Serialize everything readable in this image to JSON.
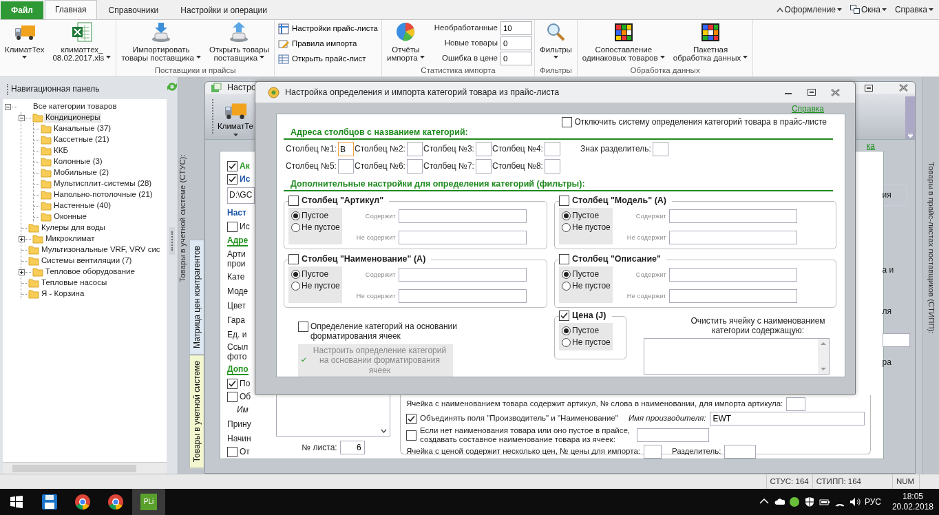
{
  "menu_tabs": [
    {
      "label": "Файл",
      "kind": "file",
      "selected": false
    },
    {
      "label": "Главная",
      "kind": "tab",
      "selected": true
    },
    {
      "label": "Справочники",
      "kind": "tab",
      "selected": false
    },
    {
      "label": "Настройки и операции",
      "kind": "tab",
      "selected": false
    }
  ],
  "top_menus": [
    "Оформление",
    "Окна",
    "Справка"
  ],
  "ribbon_groups": [
    {
      "kind": "large",
      "buttons": [
        {
          "lines": [
            "КлиматТех"
          ],
          "dropdown": true
        },
        {
          "lines": [
            "климаттех_",
            "08.02.2017.xls"
          ],
          "dropdown": true
        }
      ]
    },
    {
      "kind": "large",
      "label": "Поставщики и прайсы",
      "buttons": [
        {
          "lines": [
            "Импортировать",
            "товары поставщика"
          ],
          "dropdown": true
        },
        {
          "lines": [
            "Открыть товары",
            "поставщика"
          ],
          "dropdown": true
        }
      ]
    },
    {
      "kind": "small",
      "buttons": [
        {
          "lines": [
            "Настройки прайс-листа"
          ]
        },
        {
          "lines": [
            "Правила импорта"
          ]
        },
        {
          "lines": [
            "Открыть прайс-лист"
          ]
        }
      ]
    },
    {
      "kind": "stats",
      "label": "Статистика импорта",
      "buttons": [
        {
          "lines": [
            "Отчёты",
            "импорта"
          ],
          "dropdown": true
        }
      ],
      "fields": [
        {
          "label": "Необработанные",
          "value": "10"
        },
        {
          "label": "Новые товары",
          "value": "0"
        },
        {
          "label": "Ошибка в цене",
          "value": "0"
        }
      ]
    },
    {
      "kind": "large",
      "label": "Фильтры",
      "buttons": [
        {
          "lines": [
            "Фильтры"
          ],
          "dropdown": true
        }
      ]
    },
    {
      "kind": "large",
      "label": "Обработка данных",
      "buttons": [
        {
          "lines": [
            "Сопоставление",
            "одинаковых товаров"
          ],
          "dropdown": true
        },
        {
          "lines": [
            "Пакетная",
            "обработка данных"
          ],
          "dropdown": true
        }
      ]
    }
  ],
  "nav_panel": {
    "title": "Навигационная панель",
    "tree": [
      {
        "label": "Все категории товаров",
        "selected": false,
        "expanded": true,
        "children": [
          {
            "label": "Кондиционеры",
            "selected": true,
            "expanded": true,
            "children": [
              {
                "label": "Канальные (37)",
                "selected": false
              },
              {
                "label": "Кассетные (21)",
                "selected": false
              },
              {
                "label": "ККБ",
                "selected": false
              },
              {
                "label": "Колонные (3)",
                "selected": false
              },
              {
                "label": "Мобильные (2)",
                "selected": false
              },
              {
                "label": "Мультисплит-системы (28)",
                "selected": false
              },
              {
                "label": "Напольно-потолочные (21)",
                "selected": false
              },
              {
                "label": "Настенные (40)",
                "selected": false
              },
              {
                "label": "Оконные",
                "selected": false
              }
            ]
          },
          {
            "label": "Кулеры для воды",
            "selected": false
          },
          {
            "label": "Микроклимат",
            "selected": false,
            "expanded": false
          },
          {
            "label": "Мультизональные VRF, VRV сис",
            "selected": false
          },
          {
            "label": "Системы вентиляции (7)",
            "selected": false
          },
          {
            "label": "Тепловое оборудование",
            "selected": false,
            "expanded": false
          },
          {
            "label": "Тепловые насосы",
            "selected": false
          },
          {
            "label": "Я - Корзина",
            "selected": false
          }
        ]
      }
    ]
  },
  "side_strip": {
    "caption": "Товары в учетной системе (СТУС):",
    "tabs": [
      {
        "label": "Матрица цен контрагентов",
        "selected": false
      },
      {
        "label": "Товары в учетной системе",
        "selected": true
      }
    ]
  },
  "background_window": {
    "title": "Настро",
    "toolbar_button": "КлиматТе",
    "help_link": "ка",
    "left_fragments": [
      {
        "kind": "check-heading",
        "checked": true,
        "text": "Ак",
        "color": "#24951f"
      },
      {
        "kind": "check-heading",
        "checked": true,
        "text": "Ис",
        "color": "#1c56a8"
      },
      {
        "kind": "field",
        "text": "D:\\GC"
      },
      {
        "kind": "heading",
        "text": "Наст",
        "color": "#1c56a8",
        "underline": false
      },
      {
        "kind": "check",
        "checked": false,
        "text": "Ис"
      },
      {
        "kind": "heading",
        "text": "Адре",
        "color": "#24951f",
        "underline": true
      },
      {
        "kind": "text",
        "lines": [
          "Арти",
          "прои"
        ]
      },
      {
        "kind": "text",
        "lines": [
          "Кате"
        ]
      },
      {
        "kind": "text",
        "lines": [
          "Моде"
        ]
      },
      {
        "kind": "text",
        "lines": [
          "Цвет"
        ]
      },
      {
        "kind": "text",
        "lines": [
          "Гара"
        ]
      },
      {
        "kind": "text",
        "lines": [
          "Ед. и"
        ]
      },
      {
        "kind": "text",
        "lines": [
          "Ссыл",
          "фото"
        ]
      },
      {
        "kind": "heading",
        "text": "Допо",
        "color": "#24951f",
        "underline": true
      },
      {
        "kind": "check",
        "checked": true,
        "text": "По"
      },
      {
        "kind": "check",
        "checked": false,
        "text": "Об"
      },
      {
        "kind": "italic",
        "text": "Им"
      },
      {
        "kind": "text",
        "lines": [
          "Прину"
        ]
      },
      {
        "kind": "text",
        "lines": [
          "Начин"
        ]
      },
      {
        "kind": "check",
        "checked": false,
        "text": "От"
      }
    ],
    "right_fragments": [
      {
        "kind": "boxed",
        "text": "ия"
      },
      {
        "kind": "text",
        "text": "а и"
      },
      {
        "kind": "text",
        "text": "ля"
      },
      {
        "kind": "field"
      },
      {
        "kind": "text",
        "text": "ра"
      }
    ],
    "sheet_number": {
      "label": "№ листа:",
      "value": "6"
    },
    "options": [
      {
        "kind": "short",
        "text": "Ячейка с наименованием товара содержит артикул, № слова в наименовании, для импорта артикула:"
      },
      {
        "kind": "merge",
        "checked": true,
        "text": "Объединять поля \"Производитель\" и \"Наименование\"",
        "extra_label": "Имя производителя:",
        "value": "EWT"
      },
      {
        "kind": "compose",
        "checked": false,
        "text": "Если нет наименования товара или оно пустое в прайсе, создавать составное наименование товара из ячеек:"
      },
      {
        "kind": "split",
        "text": "Ячейка с ценой содержит несколько цен, № цены для импорта:",
        "extra_label": "Разделитель:"
      }
    ]
  },
  "dialog": {
    "title": "Настройка определения и импорта категорий товара из прайс-листа",
    "help_link": "Справка",
    "disable_option": {
      "label": "Отключить систему определения категорий товара в прайс-листе",
      "checked": false
    },
    "columns_heading": "Адреса столбцов с названием категорий:",
    "columns": [
      {
        "label": "Столбец №1:",
        "value": "B",
        "focused": true
      },
      {
        "label": "Столбец №2:",
        "focused": false
      },
      {
        "label": "Столбец №3:",
        "focused": false
      },
      {
        "label": "Столбец №4:",
        "focused": false
      },
      {
        "label": "Столбец №5:",
        "focused": false
      },
      {
        "label": "Столбец №6:",
        "focused": false
      },
      {
        "label": "Столбец №7:",
        "focused": false
      },
      {
        "label": "Столбец №8:",
        "focused": false
      }
    ],
    "separator_label": "Знак разделитель:",
    "filters_heading": "Дополнительные настройки для определения категорий (фильтры):",
    "filters": [
      {
        "title": "Столбец \"Артикул\"",
        "checked": false,
        "options": [
          {
            "label": "Пустое",
            "selected": true
          },
          {
            "label": "Не пустое",
            "selected": false
          }
        ],
        "fields": [
          "Содержит",
          "Не содержит"
        ]
      },
      {
        "title": "Столбец \"Модель\" (A)",
        "checked": false,
        "options": [
          {
            "label": "Пустое",
            "selected": true
          },
          {
            "label": "Не пустое",
            "selected": false
          }
        ],
        "fields": [
          "Содержит",
          "Не содержит"
        ]
      },
      {
        "title": "Столбец \"Наименование\" (A)",
        "checked": false,
        "options": [
          {
            "label": "Пустое",
            "selected": true
          },
          {
            "label": "Не пустое",
            "selected": false
          }
        ],
        "fields": [
          "Содержит",
          "Не содержит"
        ]
      },
      {
        "title": "Столбец \"Описание\"",
        "checked": false,
        "options": [
          {
            "label": "Пустое",
            "selected": true
          },
          {
            "label": "Не пустое",
            "selected": false
          }
        ],
        "fields": [
          "Содержит",
          "Не содержит"
        ]
      }
    ],
    "price_filter": {
      "title": "Цена (J)",
      "checked": true,
      "options": [
        {
          "label": "Пустое",
          "selected": true
        },
        {
          "label": "Не пустое",
          "selected": false
        }
      ]
    },
    "format_option": {
      "label": "Определение категорий на основании форматирования ячеек",
      "checked": false
    },
    "format_button": {
      "label": "Настроить определение категорий на основании форматирования ячеек",
      "disabled": true
    },
    "clear_label": "Очистить ячейку с наименованием категории содержащую:"
  },
  "right_strip": "Товары в прайс-листах поставщиков (СТИПП):",
  "status_bar": [
    "СТУС: 164",
    "СТИПП: 164",
    "NUM"
  ],
  "taskbar": {
    "apps": [
      {
        "selected": false
      },
      {
        "selected": false
      },
      {
        "selected": false
      },
      {
        "label": "PLi",
        "selected": true
      }
    ],
    "language": "РУС",
    "time": "18:05",
    "date": "20.02.2018"
  }
}
